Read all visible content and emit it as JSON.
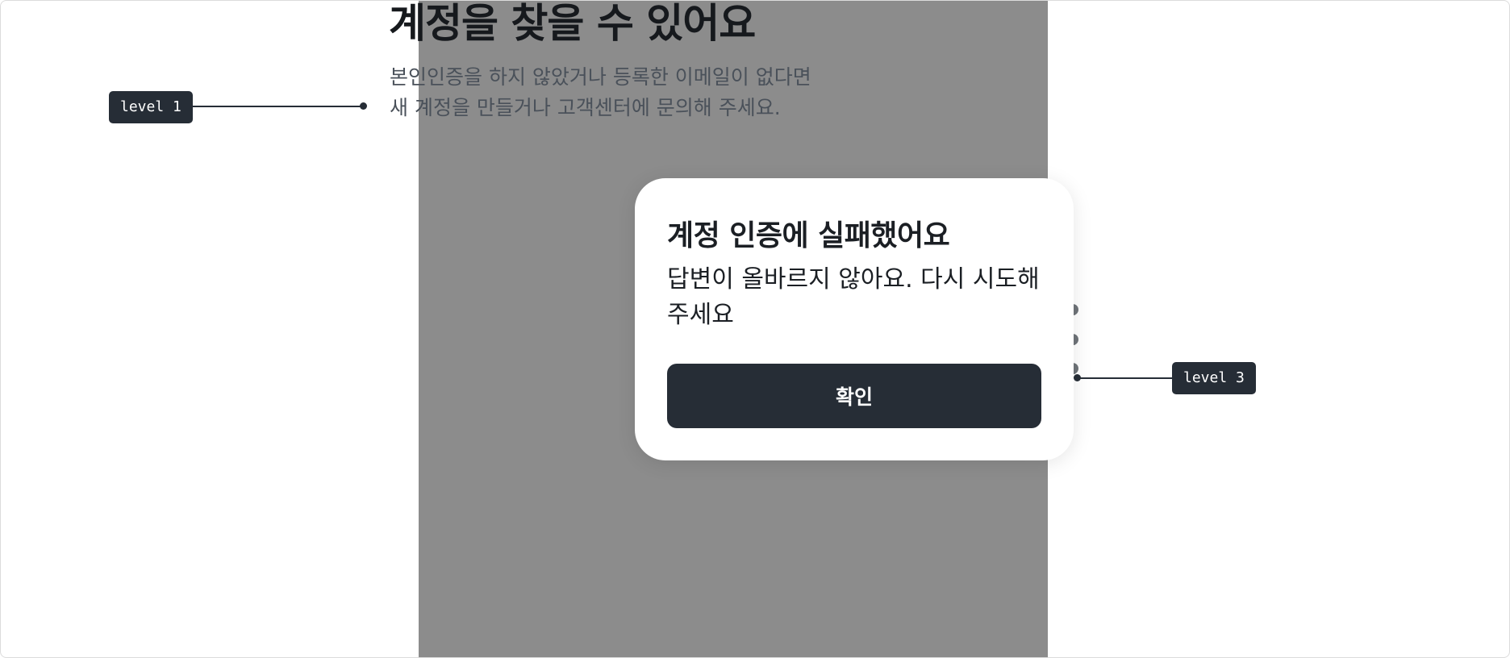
{
  "background": {
    "title": "계정을 찾을 수 있어요",
    "description_lines": [
      "본인인증을 하지 않았거나 등록한 이메일이 없다면",
      "새 계정을 만들거나 고객센터에 문의해 주세요."
    ]
  },
  "dialog": {
    "title": "계정 인증에 실패했어요",
    "message": "답변이 올바르지 않아요. 다시 시도해 주세요",
    "confirm_label": "확인"
  },
  "annotations": [
    {
      "label": "level 1"
    },
    {
      "label": "level 3"
    }
  ],
  "colors": {
    "overlay": "#8c8c8c",
    "dialog_bg": "#ffffff",
    "button_bg": "#262d36",
    "tag_bg": "#262d36",
    "title_text": "#16191d",
    "body_text": "#4a515a"
  }
}
